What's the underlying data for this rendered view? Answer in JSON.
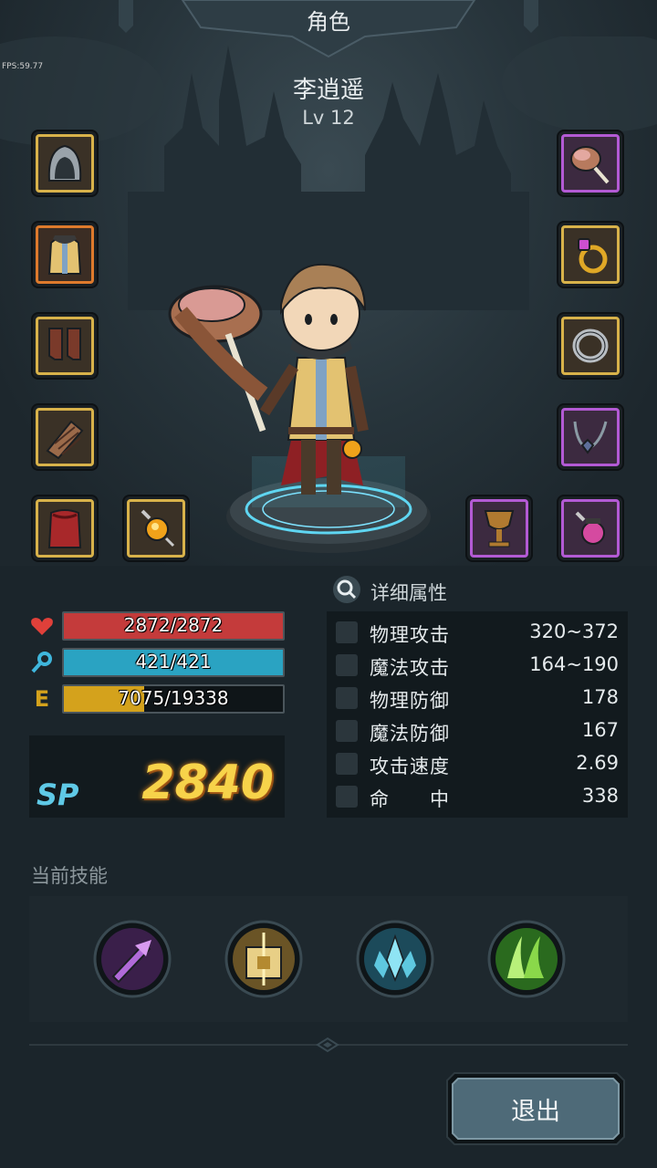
{
  "header": {
    "title": "角色",
    "fps": "FPS:59.77"
  },
  "character": {
    "name": "李逍遥",
    "level": "Lv 12"
  },
  "equipment": {
    "left": [
      "hood-icon",
      "tunic-icon",
      "boots-icon",
      "bracer-icon",
      "cape-icon",
      "amulet-gem-icon"
    ],
    "right": [
      "ham-weapon-icon",
      "gold-ring-icon",
      "silver-ring-icon",
      "necklace-icon",
      "goblet-icon",
      "potion-gem-icon"
    ]
  },
  "stats": {
    "hp": {
      "text": "2872/2872",
      "current": 2872,
      "max": 2872,
      "color": "#c43b3b"
    },
    "mp": {
      "text": "421/421",
      "current": 421,
      "max": 421,
      "color": "#2aa3c2"
    },
    "exp": {
      "label": "E",
      "text": "7075/19338",
      "current": 7075,
      "max": 19338,
      "color": "#d4a21c"
    }
  },
  "sp": {
    "label": "SP",
    "value": "2840"
  },
  "attributes": {
    "title": "详细属性",
    "rows": [
      {
        "name": "物理攻击",
        "value": "320~372"
      },
      {
        "name": "魔法攻击",
        "value": "164~190"
      },
      {
        "name": "物理防御",
        "value": "178"
      },
      {
        "name": "魔法防御",
        "value": "167"
      },
      {
        "name": "攻击速度",
        "value": "2.69"
      },
      {
        "name": "命　　中",
        "value": "338"
      }
    ]
  },
  "skills": {
    "title": "当前技能",
    "icons": [
      "purple-sword-skill-icon",
      "golden-shield-skill-icon",
      "ice-crystal-skill-icon",
      "green-wind-skill-icon"
    ]
  },
  "exit_button": {
    "label": "退出"
  }
}
